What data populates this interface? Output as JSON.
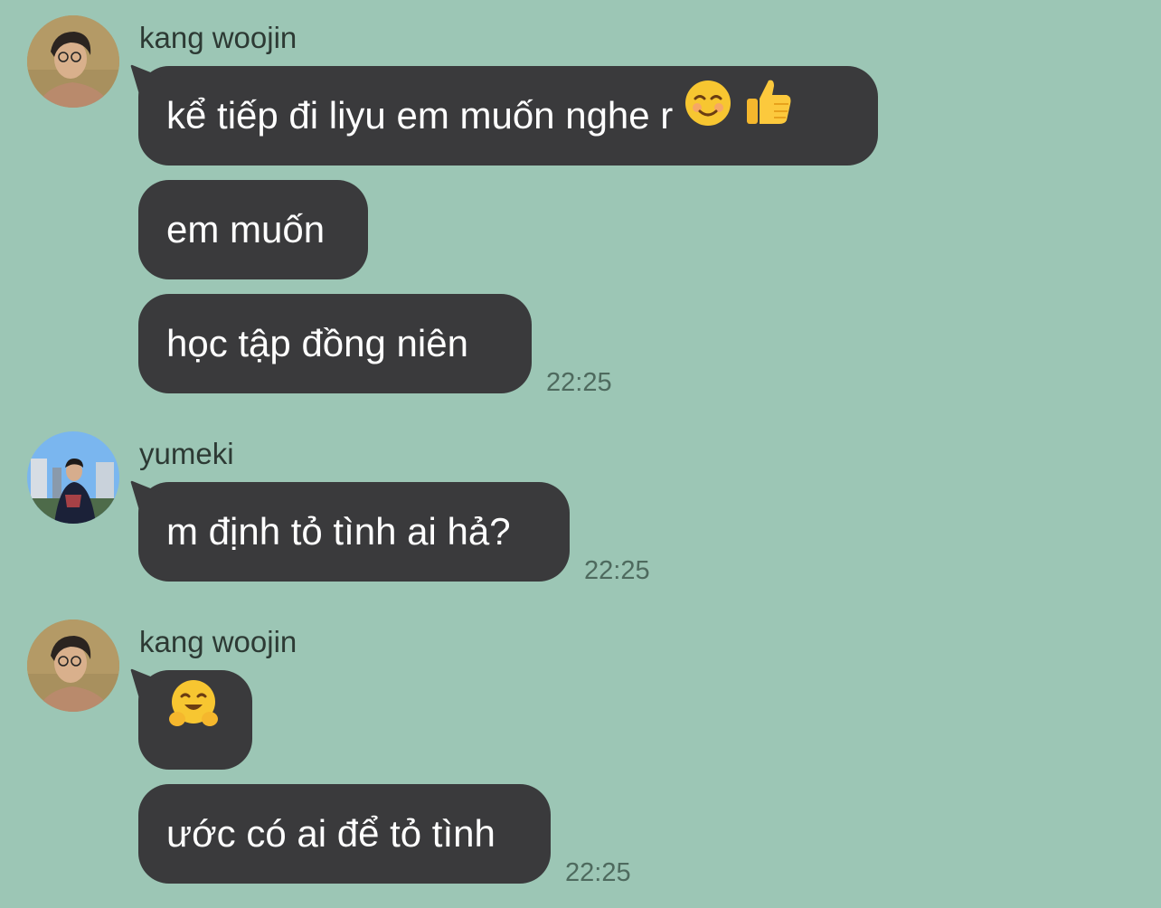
{
  "theme": {
    "background": "#9cc6b5",
    "bubble": "#3a3a3c",
    "bubble_text": "#ffffff",
    "sender_text": "#2d3a34",
    "time_text": "#4e6a5e"
  },
  "groups": [
    {
      "sender": "kang woojin",
      "avatar": "avatar-kang-woojin",
      "messages": [
        {
          "text": "kể tiếp đi liyu em muốn nghe r",
          "emojis": [
            "smiling-face-icon",
            "thumbs-up-icon"
          ]
        },
        {
          "text": "em muốn"
        },
        {
          "text": "học tập đồng niên"
        }
      ],
      "time": "22:25"
    },
    {
      "sender": "yumeki",
      "avatar": "avatar-yumeki",
      "messages": [
        {
          "text": "m định tỏ tình ai hả?"
        }
      ],
      "time": "22:25"
    },
    {
      "sender": "kang woojin",
      "avatar": "avatar-kang-woojin",
      "messages": [
        {
          "text": "",
          "emojis": [
            "hugging-face-icon"
          ]
        },
        {
          "text": "ước có ai để tỏ tình"
        }
      ],
      "time": "22:25"
    }
  ]
}
